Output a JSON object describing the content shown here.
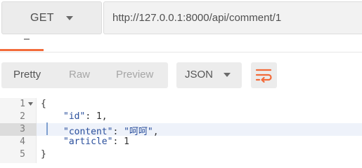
{
  "request": {
    "method": "GET",
    "url": "http://127.0.0.1:8000/api/comment/1"
  },
  "tabs": {
    "active_indicator_color": "#f26b3a"
  },
  "response_view": {
    "modes": [
      "Pretty",
      "Raw",
      "Preview"
    ],
    "active_mode": "Pretty",
    "format": "JSON",
    "wrap_icon": "wrap-lines-icon",
    "wrap_icon_color": "#f26b3a"
  },
  "editor": {
    "active_line": 3,
    "lines": [
      {
        "number": "1",
        "foldable": true,
        "text": "{"
      },
      {
        "number": "2",
        "foldable": false,
        "key": "\"id\"",
        "sep": ": ",
        "value": "1",
        "tail": ","
      },
      {
        "number": "3",
        "foldable": false,
        "key": "\"content\"",
        "sep": ": ",
        "value": "\"呵呵\"",
        "tail": ","
      },
      {
        "number": "4",
        "foldable": false,
        "key": "\"article\"",
        "sep": ": ",
        "value": "1",
        "tail": ""
      },
      {
        "number": "5",
        "foldable": false,
        "text": "}"
      }
    ]
  }
}
